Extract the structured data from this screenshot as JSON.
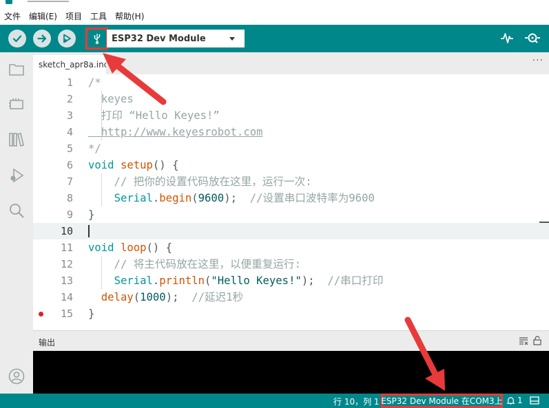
{
  "menu": [
    "文件",
    "编辑(E)",
    "项目",
    "工具",
    "帮助(H)"
  ],
  "toolbar": {
    "verify_icon": "check-icon",
    "upload_icon": "arrow-right-icon",
    "debug_icon": "debug-icon",
    "usb_icon": "usb-icon",
    "board_name": "ESP32 Dev Module",
    "serial_plotter_icon": "pulse-icon",
    "serial_monitor_icon": "magnifier-icon"
  },
  "sidebar": {
    "items": [
      "folder-icon",
      "board-icon",
      "library-icon",
      "debug-icon",
      "search-icon"
    ],
    "bottom": "account-icon"
  },
  "tab": {
    "filename": "sketch_apr8a.ino",
    "more": "···"
  },
  "editor": {
    "current_line": 10,
    "breakpoint_line": 15,
    "lines": [
      {
        "n": "1",
        "t": "/*"
      },
      {
        "n": "2",
        "t": "  keyes"
      },
      {
        "n": "3",
        "t": "  打印 “Hello Keyes!”"
      },
      {
        "n": "4",
        "t": "  http://www.keyesrobot.com"
      },
      {
        "n": "5",
        "t": "*/"
      },
      {
        "n": "6",
        "t": "void setup() {"
      },
      {
        "n": "7",
        "t": "    // 把你的设置代码放在这里，运行一次:"
      },
      {
        "n": "8",
        "t": "    Serial.begin(9600);  //设置串口波特率为9600"
      },
      {
        "n": "9",
        "t": "}"
      },
      {
        "n": "10",
        "t": ""
      },
      {
        "n": "11",
        "t": "void loop() {"
      },
      {
        "n": "12",
        "t": "    // 将主代码放在这里，以便重复运行:"
      },
      {
        "n": "13",
        "t": "    Serial.println(\"Hello Keyes!\");  //串口打印"
      },
      {
        "n": "14",
        "t": "  delay(1000);  //延迟1秒"
      },
      {
        "n": "15",
        "t": "}"
      }
    ]
  },
  "output": {
    "title": "输出"
  },
  "status": {
    "position": "行 10，列 1",
    "board_port": "ESP32 Dev Module 在COM3上",
    "notifications": "1"
  },
  "colors": {
    "teal": "#00878a",
    "highlight_red": "#e63b3b"
  }
}
